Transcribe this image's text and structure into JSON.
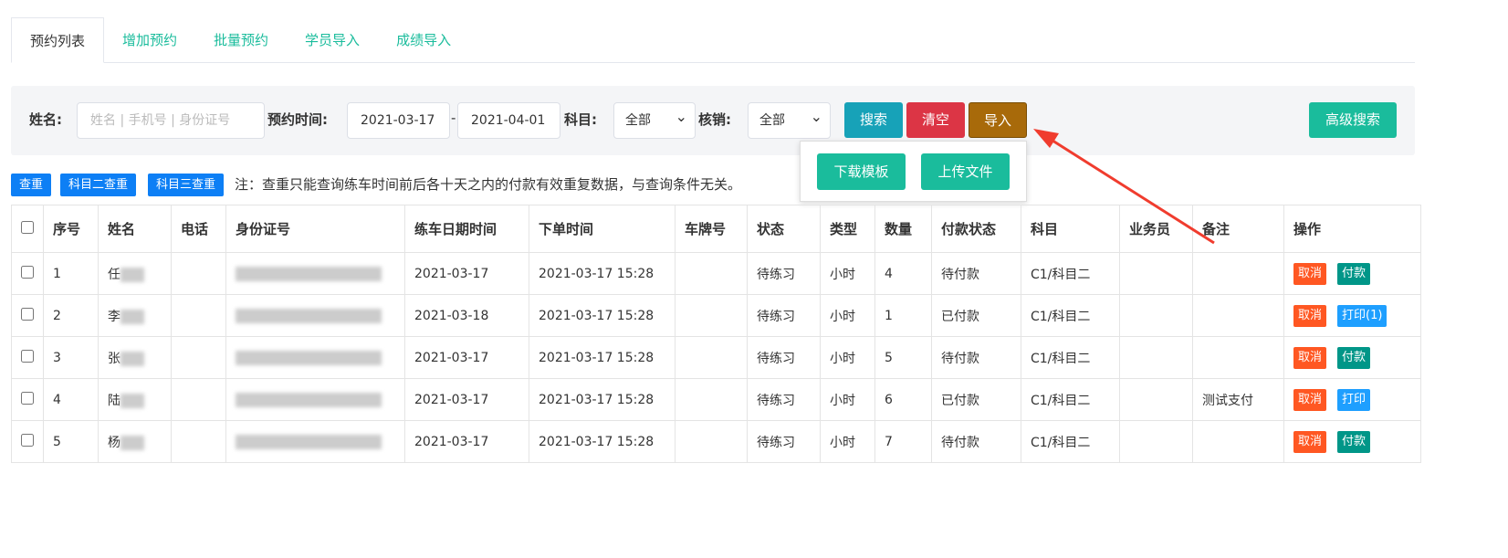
{
  "tabs": [
    "预约列表",
    "增加预约",
    "批量预约",
    "学员导入",
    "成绩导入"
  ],
  "filter": {
    "name_label": "姓名:",
    "name_placeholder": "姓名 | 手机号 | 身份证号",
    "time_label": "预约时间:",
    "date_from": "2021-03-17",
    "date_sep": "-",
    "date_to": "2021-04-01",
    "subject_label": "科目:",
    "subject_value": "全部",
    "verify_label": "核销:",
    "verify_value": "全部",
    "search": "搜索",
    "clear": "清空",
    "import": "导入",
    "advanced": "高级搜索"
  },
  "import_menu": {
    "download": "下载模板",
    "upload": "上传文件"
  },
  "dup": {
    "check": "查重",
    "check2": "科目二查重",
    "check3": "科目三查重",
    "note": "注：查重只能查询练车时间前后各十天之内的付款有效重复数据，与查询条件无关。"
  },
  "columns": [
    "序号",
    "姓名",
    "电话",
    "身份证号",
    "练车日期时间",
    "下单时间",
    "车牌号",
    "状态",
    "类型",
    "数量",
    "付款状态",
    "科目",
    "业务员",
    "备注",
    "操作"
  ],
  "rows": [
    {
      "no": "1",
      "name": "任",
      "phone": "",
      "date": "2021-03-17",
      "order": "2021-03-17 15:28",
      "plate": "",
      "status": "待练习",
      "type": "小时",
      "qty": "4",
      "pay": "待付款",
      "subject": "C1/科目二",
      "staff": "",
      "remark": "",
      "a1": "取消",
      "a2": "付款",
      "a2type": "pay"
    },
    {
      "no": "2",
      "name": "李",
      "phone": "",
      "date": "2021-03-18",
      "order": "2021-03-17 15:28",
      "plate": "",
      "status": "待练习",
      "type": "小时",
      "qty": "1",
      "pay": "已付款",
      "subject": "C1/科目二",
      "staff": "",
      "remark": "",
      "a1": "取消",
      "a2": "打印(1)",
      "a2type": "print"
    },
    {
      "no": "3",
      "name": "张",
      "phone": "",
      "date": "2021-03-17",
      "order": "2021-03-17 15:28",
      "plate": "",
      "status": "待练习",
      "type": "小时",
      "qty": "5",
      "pay": "待付款",
      "subject": "C1/科目二",
      "staff": "",
      "remark": "",
      "a1": "取消",
      "a2": "付款",
      "a2type": "pay"
    },
    {
      "no": "4",
      "name": "陆",
      "phone": "",
      "date": "2021-03-17",
      "order": "2021-03-17 15:28",
      "plate": "",
      "status": "待练习",
      "type": "小时",
      "qty": "6",
      "pay": "已付款",
      "subject": "C1/科目二",
      "staff": "",
      "remark": "测试支付",
      "a1": "取消",
      "a2": "打印",
      "a2type": "print"
    },
    {
      "no": "5",
      "name": "杨",
      "phone": "",
      "date": "2021-03-17",
      "order": "2021-03-17 15:28",
      "plate": "",
      "status": "待练习",
      "type": "小时",
      "qty": "7",
      "pay": "待付款",
      "subject": "C1/科目二",
      "staff": "",
      "remark": "",
      "a1": "取消",
      "a2": "付款",
      "a2type": "pay"
    }
  ],
  "colors": {
    "tab": "#1abc9c",
    "search": "#17a2b8",
    "clear": "#dc3545",
    "import": "#a86a0a",
    "advanced": "#1abc9c",
    "cancel": "#ff5722",
    "pay": "#009688",
    "print": "#1e9fff",
    "arrow": "#f03c2e"
  }
}
